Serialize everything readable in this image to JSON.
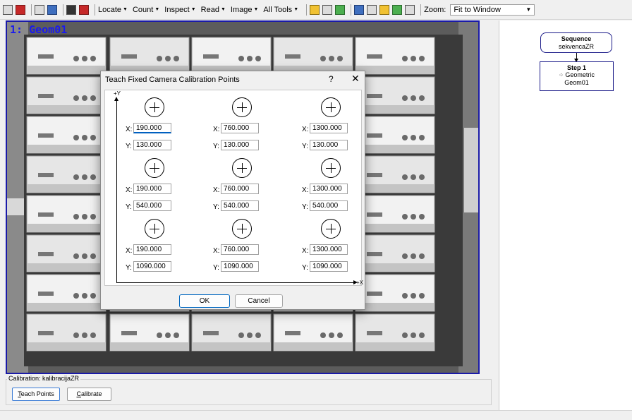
{
  "toolbar": {
    "menus": [
      {
        "label": "Locate"
      },
      {
        "label": "Count"
      },
      {
        "label": "Inspect"
      },
      {
        "label": "Read"
      },
      {
        "label": "Image"
      },
      {
        "label": "All Tools"
      }
    ],
    "zoom_label": "Zoom:",
    "zoom_value": "Fit to Window"
  },
  "viewer": {
    "label": "1: Geom01"
  },
  "dialog": {
    "title": "Teach Fixed Camera Calibration Points",
    "help": "?",
    "close": "✕",
    "axis_y": "+Y",
    "axis_x": "+X",
    "x_label": "X:",
    "y_label": "Y:",
    "points": [
      {
        "x": "190.000",
        "y": "130.000"
      },
      {
        "x": "760.000",
        "y": "130.000"
      },
      {
        "x": "1300.000",
        "y": "130.000"
      },
      {
        "x": "190.000",
        "y": "540.000"
      },
      {
        "x": "760.000",
        "y": "540.000"
      },
      {
        "x": "1300.000",
        "y": "540.000"
      },
      {
        "x": "190.000",
        "y": "1090.000"
      },
      {
        "x": "760.000",
        "y": "1090.000"
      },
      {
        "x": "1300.000",
        "y": "1090.000"
      }
    ],
    "ok_label": "OK",
    "cancel_label": "Cancel"
  },
  "calibration": {
    "title": "Calibration: kalibracijaZR",
    "teach_accel": "T",
    "teach_rest": "each Points",
    "calibrate_accel": "C",
    "calibrate_rest": "alibrate"
  },
  "sequence": {
    "title": "Sequence",
    "name": "sekvencaZR",
    "step_title": "Step 1",
    "step_tool": "Geometric",
    "step_name": "Geom01"
  },
  "colors": {
    "viewer_border": "#1a1aa8",
    "label_blue": "#1a1aee",
    "primary_button": "#0067c0"
  }
}
